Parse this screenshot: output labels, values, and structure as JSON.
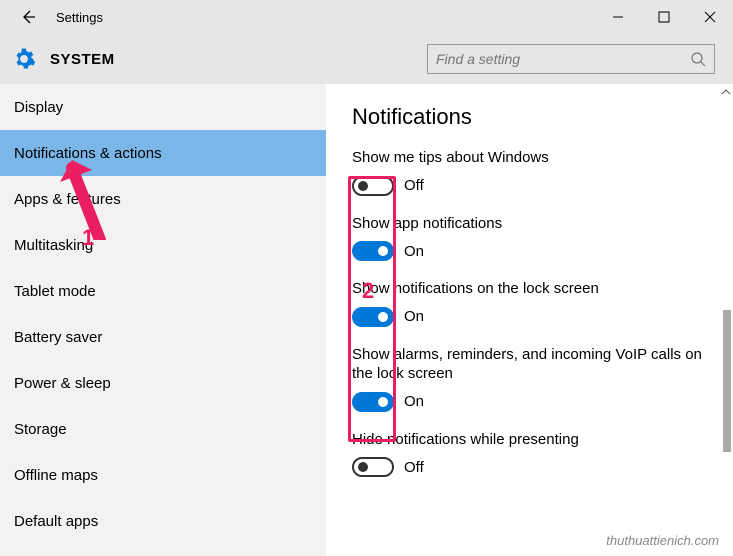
{
  "titlebar": {
    "title": "Settings"
  },
  "header": {
    "title": "SYSTEM",
    "search_placeholder": "Find a setting"
  },
  "sidebar": {
    "items": [
      {
        "label": "Display",
        "selected": false
      },
      {
        "label": "Notifications & actions",
        "selected": true
      },
      {
        "label": "Apps & features",
        "selected": false
      },
      {
        "label": "Multitasking",
        "selected": false
      },
      {
        "label": "Tablet mode",
        "selected": false
      },
      {
        "label": "Battery saver",
        "selected": false
      },
      {
        "label": "Power & sleep",
        "selected": false
      },
      {
        "label": "Storage",
        "selected": false
      },
      {
        "label": "Offline maps",
        "selected": false
      },
      {
        "label": "Default apps",
        "selected": false
      }
    ]
  },
  "content": {
    "heading": "Notifications",
    "settings": [
      {
        "label": "Show me tips about Windows",
        "on": false,
        "state": "Off"
      },
      {
        "label": "Show app notifications",
        "on": true,
        "state": "On"
      },
      {
        "label": "Show notifications on the lock screen",
        "on": true,
        "state": "On"
      },
      {
        "label": "Show alarms, reminders, and incoming VoIP calls on the lock screen",
        "on": true,
        "state": "On"
      },
      {
        "label": "Hide notifications while presenting",
        "on": false,
        "state": "Off"
      }
    ]
  },
  "annotations": {
    "num1": "1",
    "num2": "2"
  },
  "watermark": "thuthuattienich.com"
}
